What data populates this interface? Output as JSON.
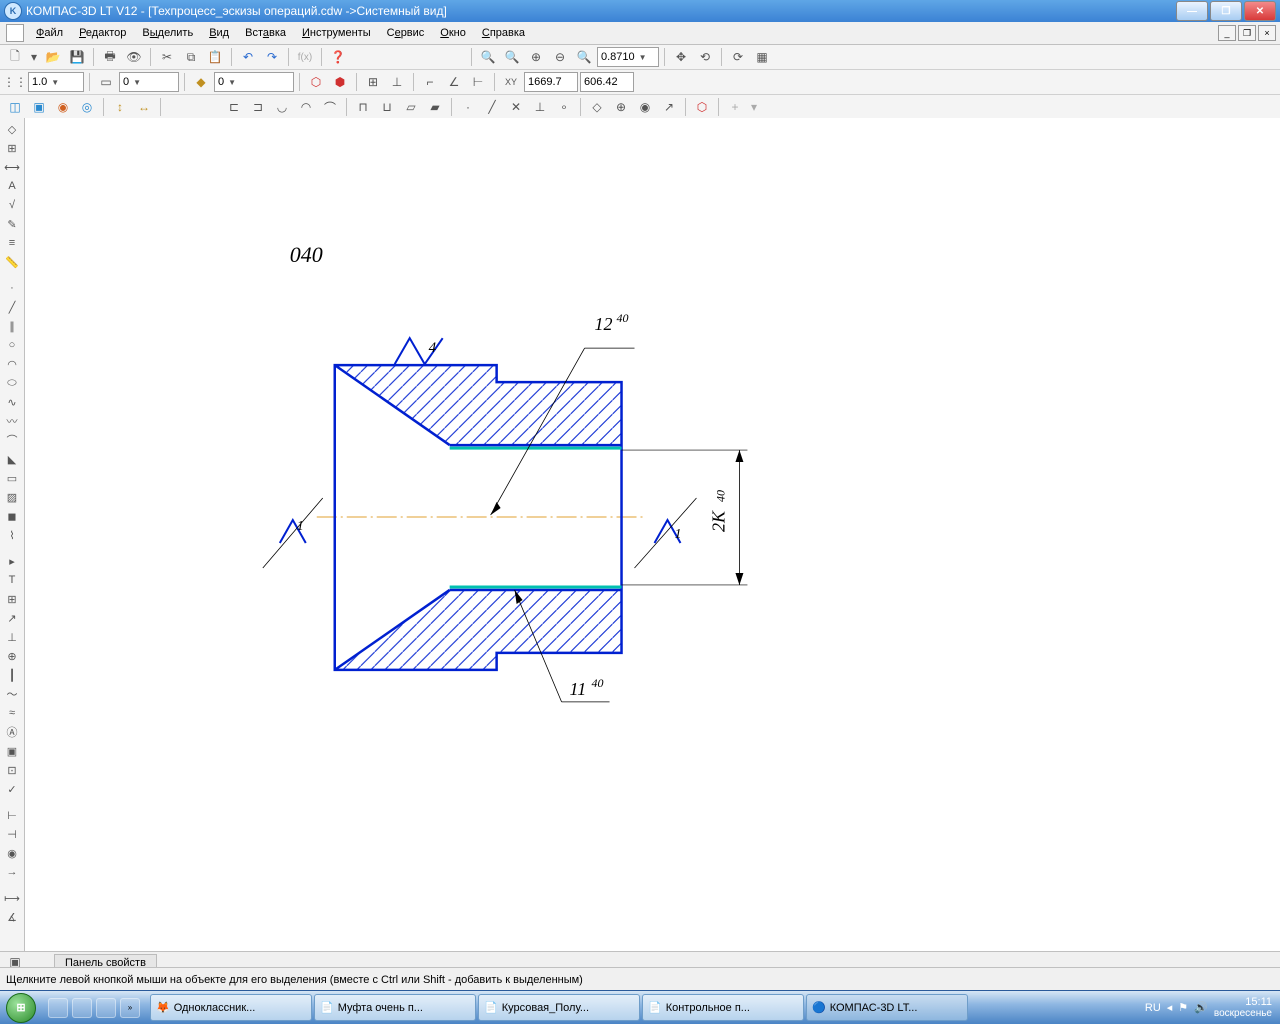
{
  "title": "КОМПАС-3D LT V12 - [Техпроцесс_эскизы операций.cdw ->Системный вид]",
  "menu": {
    "file": "Файл",
    "editor": "Редактор",
    "select": "Выделить",
    "view": "Вид",
    "insert": "Вставка",
    "tools": "Инструменты",
    "service": "Сервис",
    "window": "Окно",
    "help": "Справка"
  },
  "tb2": {
    "zoom": "0.8710",
    "x": "1669.7",
    "y": "606.42",
    "step": "1.0",
    "step2": "0",
    "angle": "0"
  },
  "panel_tab": "Панель свойств",
  "status_msg": "Щелкните левой кнопкой мыши на объекте для его выделения (вместе с Ctrl или Shift - добавить к выделенным)",
  "taskbar": {
    "items": [
      {
        "label": "Одноклассник..."
      },
      {
        "label": "Муфта очень п..."
      },
      {
        "label": "Курсовая_Полу..."
      },
      {
        "label": "Контрольное п..."
      },
      {
        "label": "КОМПАС-3D LT..."
      }
    ],
    "lang": "RU",
    "time": "15:11",
    "day": "воскресенье"
  },
  "drawing": {
    "op_num": "040",
    "dim_top": "12",
    "dim_top_sup": "40",
    "dim_bot": "11",
    "dim_bot_sup": "40",
    "dim_right": "2К",
    "dim_right_sup": "40",
    "rough1": "4",
    "rough2": "1",
    "rough3": "1"
  }
}
